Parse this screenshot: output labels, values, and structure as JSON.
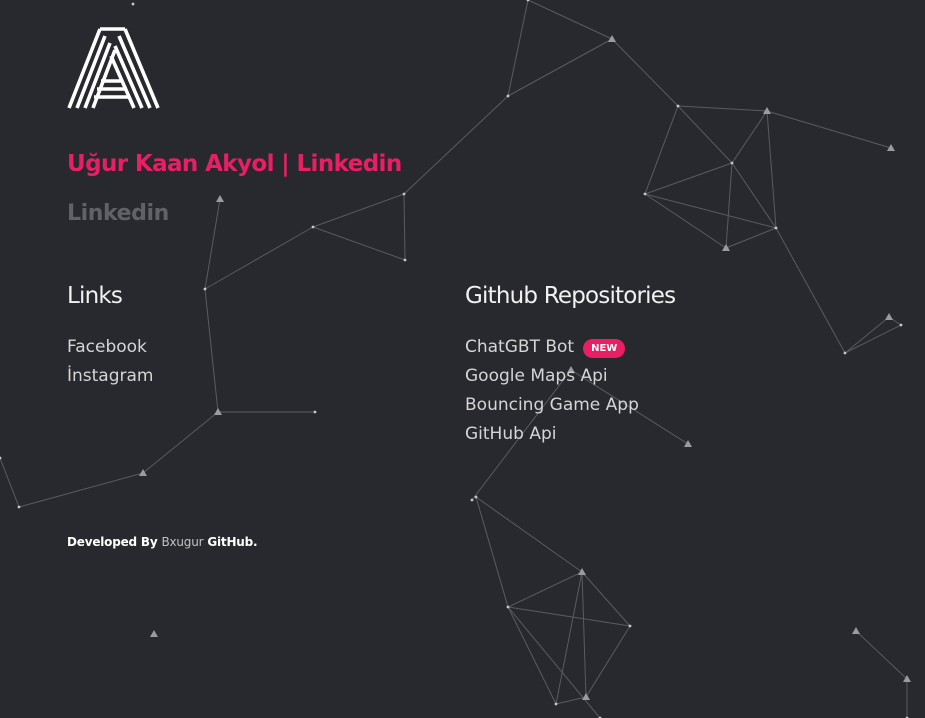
{
  "brand": {
    "logo_icon": "stylized-letter-a-logo",
    "title": "Uğur Kaan Akyol | Linkedin",
    "subtitle": "Linkedin"
  },
  "links_section": {
    "heading": "Links",
    "items": [
      {
        "label": "Facebook"
      },
      {
        "label": "İnstagram"
      }
    ]
  },
  "repos_section": {
    "heading": "Github Repositories",
    "items": [
      {
        "label": "ChatGBT Bot",
        "badge": "NEW"
      },
      {
        "label": "Google Maps Api"
      },
      {
        "label": "Bouncing Game App"
      },
      {
        "label": "GitHub Api"
      }
    ]
  },
  "footer": {
    "prefix": "Developed By",
    "author": "Bxugur",
    "suffix": "GitHub."
  },
  "colors": {
    "background": "#28292e",
    "accent": "#e91e63",
    "muted": "#616266",
    "text": "#d5d5d5"
  }
}
